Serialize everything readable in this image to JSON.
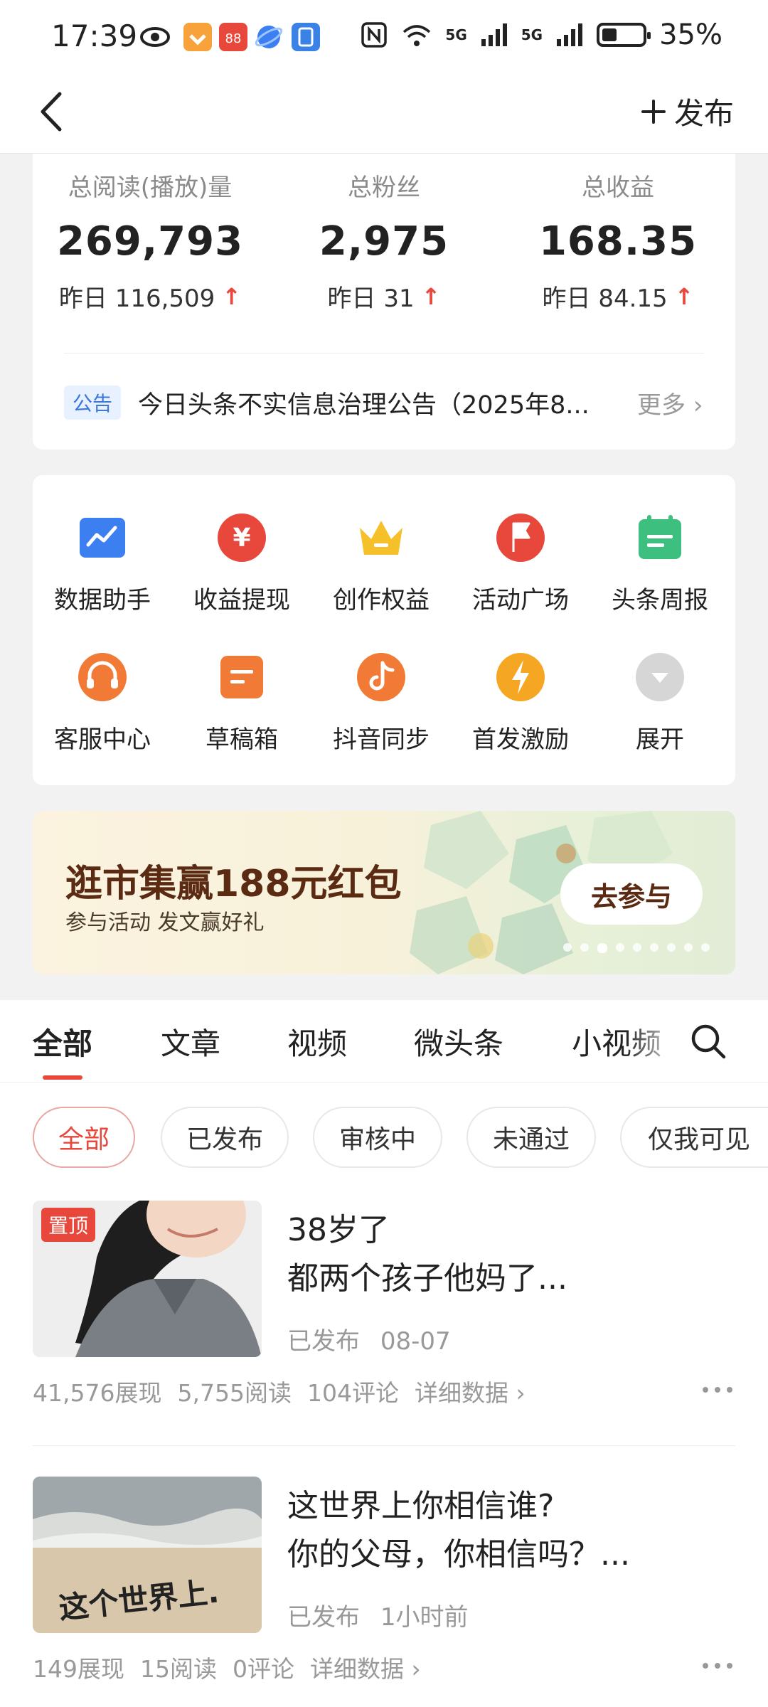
{
  "status": {
    "time": "17:39",
    "battery": "35%",
    "net1": "5G",
    "net2": "5G"
  },
  "nav": {
    "publish_label": "发布"
  },
  "stats": [
    {
      "label": "总阅读(播放)量",
      "value": "269,793",
      "yesterday": "昨日 116,509"
    },
    {
      "label": "总粉丝",
      "value": "2,975",
      "yesterday": "昨日 31"
    },
    {
      "label": "总收益",
      "value": "168.35",
      "yesterday": "昨日 84.15"
    }
  ],
  "notice": {
    "tag": "公告",
    "text": "今日头条不实信息治理公告（2025年8...",
    "more": "更多"
  },
  "tools": [
    {
      "label": "数据助手",
      "icon": "chart-icon",
      "color": "#3b7ff0"
    },
    {
      "label": "收益提现",
      "icon": "yuan-icon",
      "color": "#e8483b"
    },
    {
      "label": "创作权益",
      "icon": "crown-icon",
      "color": "#f5c02a"
    },
    {
      "label": "活动广场",
      "icon": "flag-icon",
      "color": "#e8483b"
    },
    {
      "label": "头条周报",
      "icon": "calendar-icon",
      "color": "#3dbf80"
    },
    {
      "label": "客服中心",
      "icon": "headset-icon",
      "color": "#f07a36"
    },
    {
      "label": "草稿箱",
      "icon": "draft-icon",
      "color": "#f07a36"
    },
    {
      "label": "抖音同步",
      "icon": "douyin-icon",
      "color": "#f07a36"
    },
    {
      "label": "首发激励",
      "icon": "lightning-icon",
      "color": "#f5a623"
    },
    {
      "label": "展开",
      "icon": "expand-icon",
      "color": "#cccccc"
    }
  ],
  "banner": {
    "title": "逛市集赢188元红包",
    "subtitle": "参与活动 发文赢好礼",
    "button": "去参与"
  },
  "tabs": [
    "全部",
    "文章",
    "视频",
    "微头条",
    "小视频"
  ],
  "chips": [
    "全部",
    "已发布",
    "审核中",
    "未通过",
    "仅我可见"
  ],
  "posts": [
    {
      "pin": "置顶",
      "title_line1": "38岁了",
      "title_line2": "都两个孩子他妈了...",
      "status": "已发布",
      "time": "08-07",
      "impressions": "41,576展现",
      "reads": "5,755阅读",
      "comments": "104评论",
      "detail": "详细数据"
    },
    {
      "title_line1": "这世界上你相信谁?",
      "title_line2": "你的父母，你相信吗？...",
      "status": "已发布",
      "time": "1小时前",
      "impressions": "149展现",
      "reads": "15阅读",
      "comments": "0评论",
      "detail": "详细数据",
      "thumb_text": "这个世界上."
    }
  ]
}
